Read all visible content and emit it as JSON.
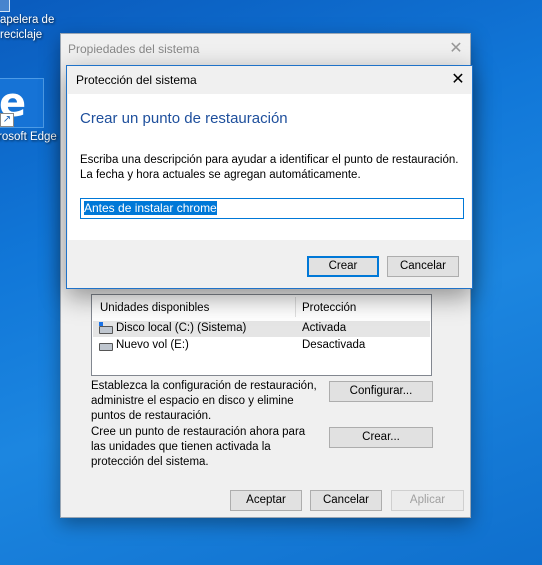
{
  "desktop": {
    "recycle_bin": {
      "line1": "apelera de",
      "line2": "reciclaje"
    },
    "edge": {
      "label": "rosoft Edge"
    }
  },
  "back_window": {
    "title": "Propiedades del sistema",
    "table": {
      "headers": [
        "Unidades disponibles",
        "Protección"
      ],
      "rows": [
        {
          "drive": "Disco local (C:) (Sistema)",
          "protection": "Activada"
        },
        {
          "drive": "Nuevo vol (E:)",
          "protection": "Desactivada"
        }
      ]
    },
    "configure_text": "Establezca la configuración de restauración, administre el espacio en disco y elimine puntos de restauración.",
    "configure_button": "Configurar...",
    "create_text": "Cree un punto de restauración ahora para las unidades que tienen activada la protección del sistema.",
    "create_button": "Crear...",
    "footer": {
      "accept": "Aceptar",
      "cancel": "Cancelar",
      "apply": "Aplicar"
    }
  },
  "dialog": {
    "title": "Protección del sistema",
    "heading": "Crear un punto de restauración",
    "description": "Escriba una descripción para ayudar a identificar el punto de restauración. La fecha y hora actuales se agregan automáticamente.",
    "input_value": "Antes de instalar chrome",
    "create_button": "Crear",
    "cancel_button": "Cancelar"
  }
}
